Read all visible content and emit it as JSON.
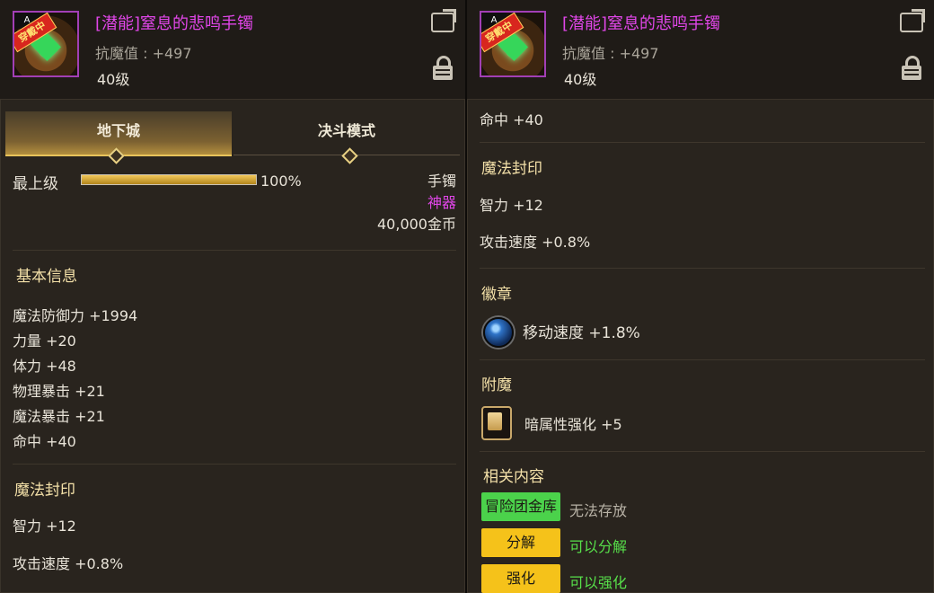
{
  "item": {
    "title": "[潜能]窒息的悲鸣手镯",
    "resist_label": "抗魔值 : +497",
    "level": "40级",
    "thumb_band": "A",
    "thumb_stamp": "穿戴中"
  },
  "tabs": [
    {
      "label": "地下城",
      "active": true
    },
    {
      "label": "决斗模式",
      "active": false
    }
  ],
  "grade": {
    "label": "最上级",
    "percent_text": "100%",
    "percent": 100
  },
  "meta": {
    "type": "手镯",
    "rarity": "神器",
    "price": "40,000金币"
  },
  "sections": {
    "basic": {
      "title": "基本信息",
      "stats": [
        "魔法防御力 +1994",
        "力量 +20",
        "体力 +48",
        "物理暴击 +21",
        "魔法暴击 +21",
        "命中 +40"
      ]
    },
    "seal": {
      "title": "魔法封印",
      "stats": [
        "智力 +12",
        "攻击速度 +0.8%"
      ]
    },
    "emblem": {
      "title": "徽章",
      "item": "移动速度 +1.8%"
    },
    "enchant": {
      "title": "附魔",
      "item": "暗属性强化 +5"
    },
    "related": {
      "title": "相关内容",
      "rows": [
        {
          "tag": "冒险团金库",
          "status": "无法存放",
          "tag_color": "#4bd24b",
          "status_color": "#b8b2a6"
        },
        {
          "tag": "分解",
          "status": "可以分解",
          "tag_color": "#f5c21a",
          "status_color": "#57e04a"
        },
        {
          "tag": "强化",
          "status": "可以强化",
          "tag_color": "#f5c21a",
          "status_color": "#57e04a"
        }
      ]
    }
  },
  "right_top_stat": "命中 +40",
  "colors": {
    "accent_gold": "#e8c35a",
    "rarity_purple": "#e046e8",
    "title_gold": "#f3e0a8"
  }
}
